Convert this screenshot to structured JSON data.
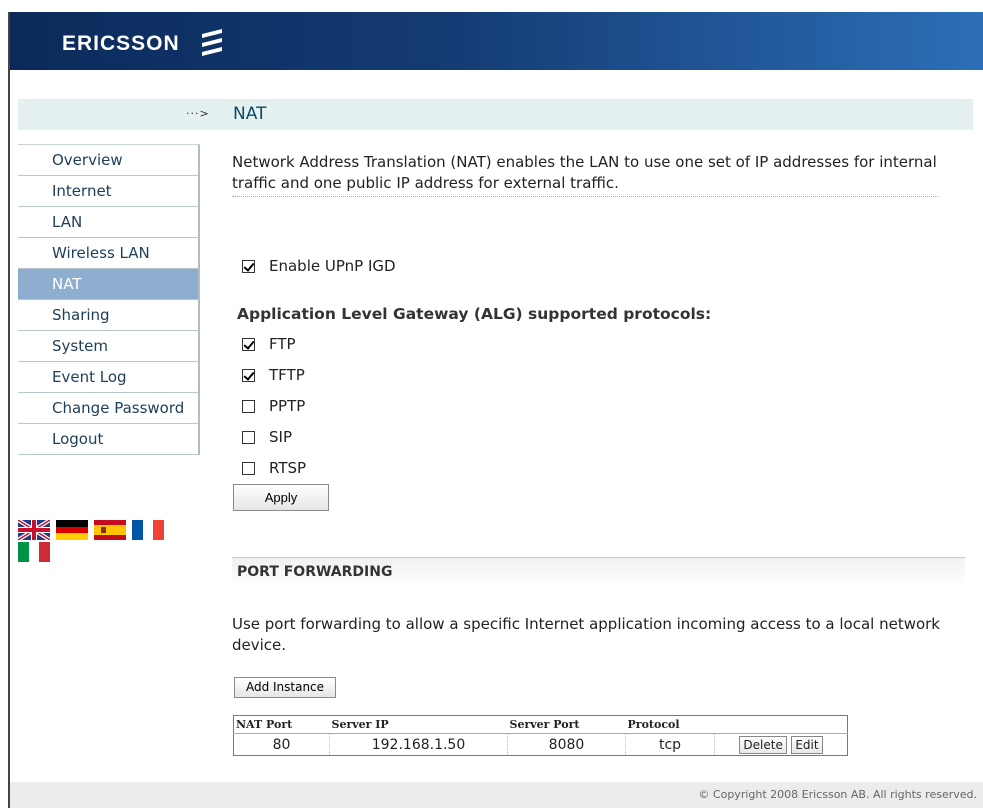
{
  "brand": {
    "name": "ERICSSON",
    "colors": {
      "header_dark": "#0b2a5a",
      "header_light": "#2c6fb8",
      "nav_active": "#8eaed0"
    }
  },
  "titlebar": {
    "arrow": "···>",
    "title": "NAT"
  },
  "sidebar": {
    "items": [
      {
        "label": "Overview",
        "active": false
      },
      {
        "label": "Internet",
        "active": false
      },
      {
        "label": "LAN",
        "active": false
      },
      {
        "label": "Wireless LAN",
        "active": false
      },
      {
        "label": "NAT",
        "active": true
      },
      {
        "label": "Sharing",
        "active": false
      },
      {
        "label": "System",
        "active": false
      },
      {
        "label": "Event Log",
        "active": false
      },
      {
        "label": "Change Password",
        "active": false
      },
      {
        "label": "Logout",
        "active": false
      }
    ]
  },
  "languages": [
    "uk-flag-icon",
    "germany-flag-icon",
    "spain-flag-icon",
    "france-flag-icon",
    "italy-flag-icon"
  ],
  "main": {
    "intro": "Network Address Translation (NAT) enables the LAN to use one set of IP addresses for internal traffic and one public IP address for external traffic.",
    "upnp": {
      "label": "Enable UPnP IGD",
      "checked": true
    },
    "alg_title": "Application Level Gateway (ALG) supported protocols:",
    "protocols": [
      {
        "label": "FTP",
        "checked": true
      },
      {
        "label": "TFTP",
        "checked": true
      },
      {
        "label": "PPTP",
        "checked": false
      },
      {
        "label": "SIP",
        "checked": false
      },
      {
        "label": "RTSP",
        "checked": false
      }
    ],
    "apply_label": "Apply"
  },
  "port_forwarding": {
    "title": "PORT FORWARDING",
    "description": "Use port forwarding to allow a specific Internet application incoming access to a local network device.",
    "add_label": "Add Instance",
    "columns": [
      "NAT Port",
      "Server IP",
      "Server Port",
      "Protocol"
    ],
    "rows": [
      {
        "nat_port": "80",
        "server_ip": "192.168.1.50",
        "server_port": "8080",
        "protocol": "tcp"
      }
    ],
    "delete_label": "Delete",
    "edit_label": "Edit"
  },
  "footer": {
    "copyright": "© Copyright 2008 Ericsson AB. All rights reserved."
  }
}
